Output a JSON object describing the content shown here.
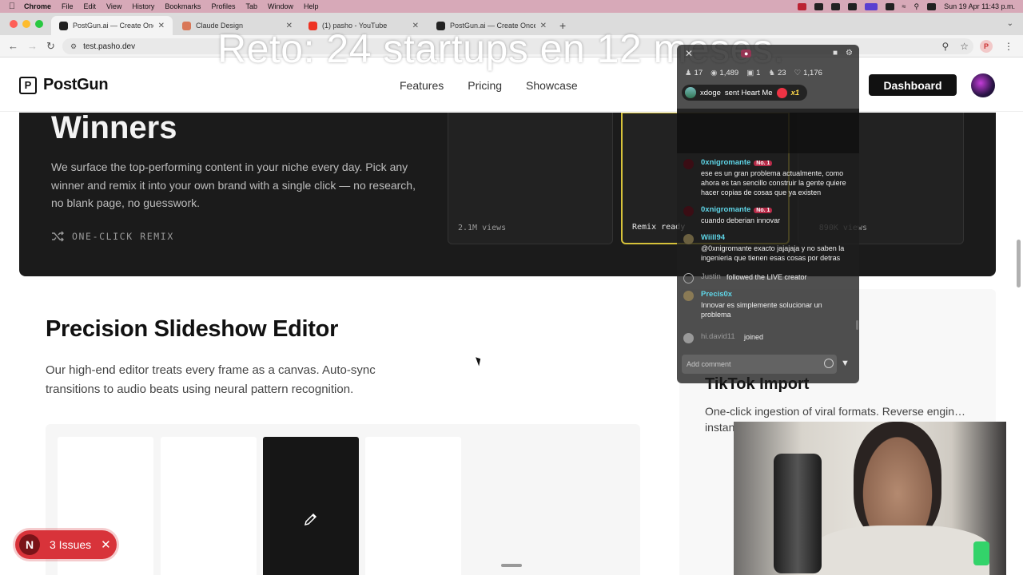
{
  "menubar": {
    "app": "Chrome",
    "items": [
      "File",
      "Edit",
      "View",
      "History",
      "Bookmarks",
      "Profiles",
      "Tab",
      "Window",
      "Help"
    ],
    "clock": "Sun 19 Apr  11:43 p.m."
  },
  "tabs": [
    {
      "title": "PostGun.ai — Create Once. D",
      "active": true
    },
    {
      "title": "Claude Design",
      "active": false
    },
    {
      "title": "(1) pasho - YouTube",
      "active": false
    },
    {
      "title": "PostGun.ai — Create Once. D",
      "active": false
    }
  ],
  "address": {
    "url": "test.pasho.dev"
  },
  "overlay_title": "Reto: 24 startups en 12 meses.",
  "site": {
    "brand": "PostGun",
    "logo_letter": "P",
    "nav": [
      "Features",
      "Pricing",
      "Showcase"
    ],
    "dashboard_label": "Dashboard"
  },
  "winners": {
    "title": "Winners",
    "description": "We surface the top-performing content in your niche every day. Pick any winner and remix it into your own brand with a single click — no research, no blank page, no guesswork.",
    "remix_label": "ONE-CLICK REMIX",
    "cards": [
      {
        "label": "2.1M views",
        "selected": false
      },
      {
        "label": "Remix ready",
        "selected": true
      },
      {
        "label": "890K views",
        "selected": false
      }
    ]
  },
  "editor": {
    "title": "Precision Slideshow Editor",
    "description": "Our high-end editor treats every frame as a canvas. Auto-sync transitions to audio beats using neural pattern recognition."
  },
  "tiktok": {
    "title": "TikTok Import",
    "description": "One-click ingestion of viral formats. Reverse engin… instan…"
  },
  "live": {
    "stats": {
      "viewers": "17",
      "views": "1,489",
      "gifts": "1",
      "followers": "23",
      "likes": "1,176"
    },
    "gift": {
      "user": "xdoge",
      "text": "sent Heart Me",
      "multiplier": "x1"
    },
    "messages": [
      {
        "user": "0xnigromante",
        "badge": "No. 1",
        "text": "ese es un gran problema actualmente, como ahora es tan sencillo construir la gente quiere hacer copias de cosas que ya existen"
      },
      {
        "user": "0xnigromante",
        "badge": "No. 1",
        "text": "cuando deberian innovar"
      },
      {
        "user": "Wiill94",
        "badge": "",
        "text": "@0xnigromante exacto jajajaja y no saben la ingenieria que tienen esas cosas por detras"
      },
      {
        "user": "Justin",
        "badge": "",
        "text": "followed the LIVE creator"
      },
      {
        "user": "Precis0x",
        "badge": "",
        "text": "Innovar es simplemente solucionar un problema"
      },
      {
        "user": "hi.david11",
        "badge": "",
        "text": "joined"
      }
    ],
    "input_placeholder": "Add comment"
  },
  "issues": {
    "initial": "N",
    "label": "3 Issues"
  },
  "colors": {
    "accent_yellow": "#d6c23a",
    "issues_red": "#d8333a",
    "chat_name": "#5fd6e8"
  }
}
